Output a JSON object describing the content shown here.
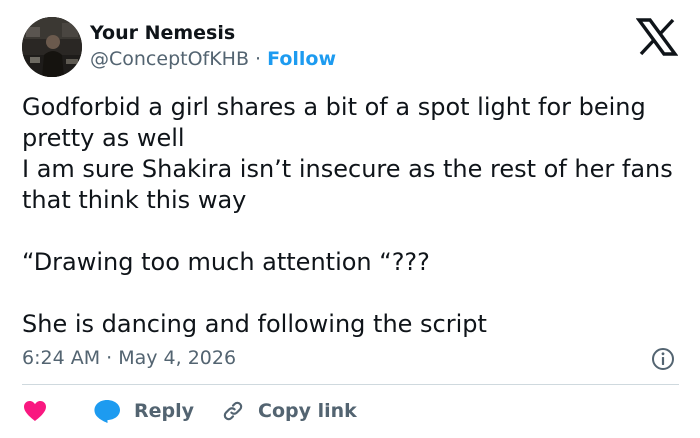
{
  "author": {
    "display_name": "Your Nemesis",
    "handle": "@ConceptOfKHB",
    "separator": " · ",
    "follow_label": "Follow"
  },
  "tweet": {
    "text": "Godforbid a girl shares a bit of a spot light for being pretty as well\nI am sure Shakira isn’t insecure as the rest of her fans that think this way\n\n“Drawing too much attention “???\n\nShe is dancing and following the script",
    "time": "6:24 AM",
    "separator": " · ",
    "date": "May 4, 2026"
  },
  "actions": {
    "reply_label": "Reply",
    "copy_link_label": "Copy link"
  },
  "icons": {
    "logo": "x-logo-icon",
    "info": "info-icon",
    "like": "heart-icon",
    "reply": "speech-bubble-icon",
    "copy": "link-icon"
  },
  "colors": {
    "text": "#0f1419",
    "secondary": "#536471",
    "follow": "#1d9bf0",
    "heart": "#f91880",
    "reply_bubble": "#1d9bf0",
    "divider": "#cfd9de"
  }
}
